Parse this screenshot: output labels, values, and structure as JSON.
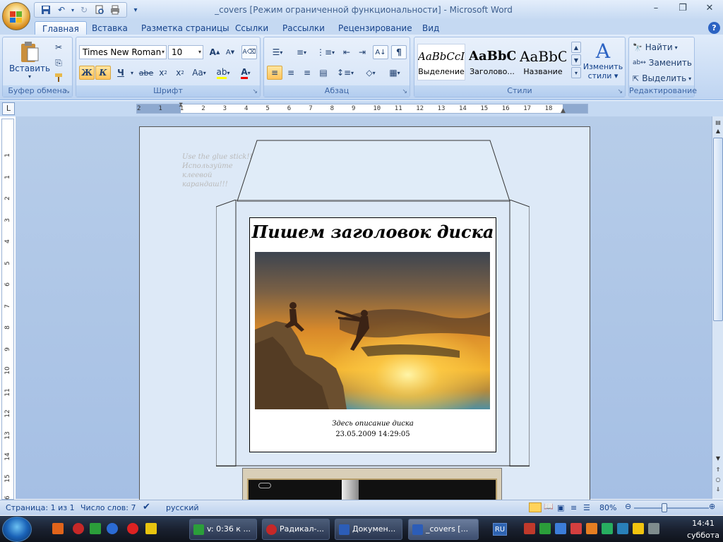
{
  "window": {
    "title": "_covers [Режим ограниченной функциональности] - Microsoft Word"
  },
  "tabs": [
    "Главная",
    "Вставка",
    "Разметка страницы",
    "Ссылки",
    "Рассылки",
    "Рецензирование",
    "Вид"
  ],
  "ribbon": {
    "clipboard": {
      "paste_label": "Вставить",
      "group_label": "Буфер обмена"
    },
    "font": {
      "name": "Times New Roman",
      "size": "10",
      "group_label": "Шрифт",
      "bold": "Ж",
      "italic": "К",
      "underline": "Ч",
      "strike": "abe",
      "case": "Aa"
    },
    "paragraph": {
      "group_label": "Абзац"
    },
    "styles": {
      "group_label": "Стили",
      "items": [
        {
          "sample": "AaBbCcI",
          "name": "Выделение"
        },
        {
          "sample": "AaBbC",
          "name": "Заголово..."
        },
        {
          "sample": "AaBbC",
          "name": "Название"
        }
      ],
      "change_styles_label_1": "Изменить",
      "change_styles_label_2": "стили"
    },
    "editing": {
      "group_label": "Редактирование",
      "find": "Найти",
      "replace": "Заменить",
      "select": "Выделить"
    }
  },
  "ruler": {
    "labels": [
      "2",
      "1",
      "1",
      "2",
      "3",
      "4",
      "5",
      "6",
      "7",
      "8",
      "9",
      "10",
      "11",
      "12",
      "13",
      "14",
      "15",
      "16",
      "17",
      "18"
    ],
    "vlabels": [
      "1",
      "1",
      "2",
      "3",
      "4",
      "5",
      "6",
      "7",
      "8",
      "9",
      "10",
      "11",
      "12",
      "13",
      "14",
      "15",
      "16"
    ]
  },
  "document": {
    "glue_note_lines": [
      "Use the glue stick!!!",
      "Используйте",
      "клеевой",
      "карандаш!!!"
    ],
    "cover_title": "Пишем заголовок диска",
    "cover_description": "Здесь описание диска",
    "cover_date": "23.05.2009 14:29:05"
  },
  "statusbar": {
    "page": "Страница: 1 из 1",
    "words": "Число слов: 7",
    "language": "русский",
    "zoom": "80%"
  },
  "taskbar": {
    "tasks": [
      {
        "label": "v: 0:36 к ...",
        "color": "#2b9e3a"
      },
      {
        "label": "Радикал-...",
        "color": "#c62828"
      },
      {
        "label": "Докумен...",
        "color": "#2c5db8"
      },
      {
        "label": "_covers [...",
        "color": "#2c5db8"
      }
    ],
    "lang": "RU",
    "clock_time": "14:41",
    "clock_day": "суббота"
  },
  "colors": {
    "ribbon": "#c5d9f2",
    "accent": "#15428b",
    "highlight": "#ffc45c"
  }
}
